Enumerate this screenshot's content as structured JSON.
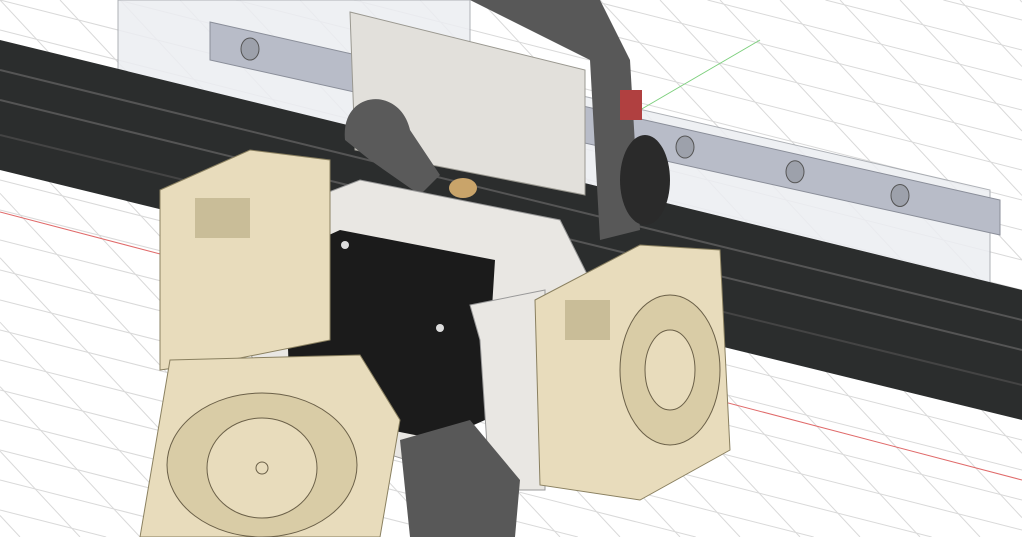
{
  "viewport": {
    "background": "#ffffff",
    "grid_color": "#d9d9d9",
    "x_axis_color": "#e06a6a",
    "y_axis_color": "#7ccf7c"
  },
  "parts": {
    "extrusion_color": "#2b2d2d",
    "rail_color": "#b8bcc8",
    "plate_color": "#e2e0db",
    "motor_color": "#1b1b1b",
    "housing_color": "#e9e7e3",
    "fan_color": "#e8dcbc",
    "dark_part_color": "#585858",
    "clear_panel_color": "#eceef2",
    "brass_color": "#c9a46a",
    "red_tab_color": "#b04040"
  },
  "icons": [
    "fan-icon",
    "fan-icon"
  ]
}
